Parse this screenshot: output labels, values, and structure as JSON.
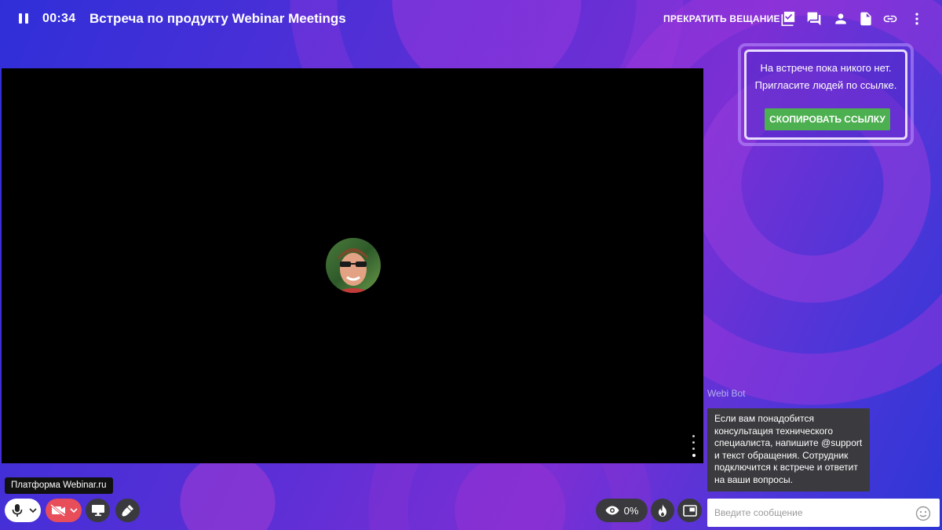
{
  "header": {
    "timer": "00:34",
    "title": "Встреча по продукту Webinar Meetings",
    "stop_broadcast_label": "ПРЕКРАТИТЬ ВЕЩАНИЕ",
    "icons": [
      "pause-icon",
      "checklist-icon",
      "chat-icon",
      "participant-icon",
      "document-icon",
      "link-icon",
      "more-vertical-icon"
    ]
  },
  "invite": {
    "line1": "На встрече пока никого нет.",
    "line2": "Пригласите людей по ссылке.",
    "copy_button": "СКОПИРОВАТЬ ССЫЛКУ"
  },
  "chat": {
    "bot_name": "Webi Bot",
    "bot_message": "Если вам понадобится консультация технического специалиста, напишите @support и текст обращения. Сотрудник подключится к встрече и ответит на ваши вопросы.",
    "input_placeholder": "Введите сообщение"
  },
  "controls": {
    "platform_tooltip": "Платформа Webinar.ru",
    "viewers_percent": "0%"
  },
  "colors": {
    "copy_button": "#4caf50",
    "camera_off": "#e84d5a",
    "control_dark": "#3a3a3e"
  }
}
